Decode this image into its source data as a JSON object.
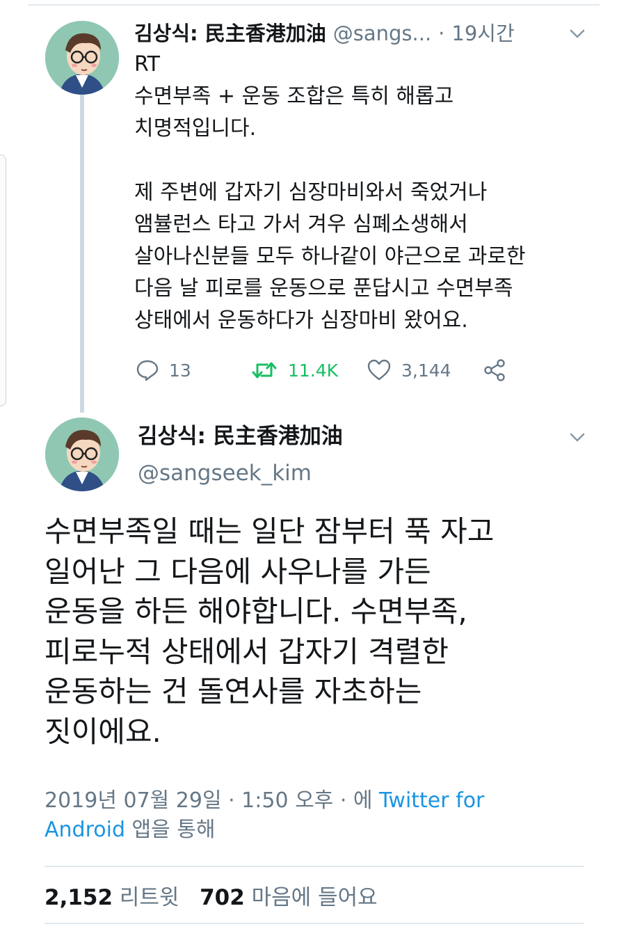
{
  "retweeted_tweet": {
    "display_name": "김상식: 民主香港加油",
    "handle_truncated": "@sangs...",
    "separator": "·",
    "time_ago": "19시간",
    "rt_label": "RT",
    "lines": [
      "수면부족 + 운동 조합은 특히 해롭고",
      "치명적입니다.",
      "",
      "제 주변에 갑자기 심장마비와서 죽었거나",
      "앰뷸런스 타고 가서 겨우 심폐소생해서",
      "살아나신분들 모두 하나같이 야근으로 과로한",
      "다음 날 피로를 운동으로 푼답시고 수면부족",
      "상태에서 운동하다가 심장마비 왔어요."
    ],
    "actions": {
      "replies": "13",
      "retweets": "11.4K",
      "likes": "3,144"
    },
    "icons": [
      "reply-icon",
      "retweet-icon",
      "like-icon",
      "share-icon",
      "chevron-down-icon"
    ],
    "colors": {
      "retweet_green": "#17bf63",
      "muted": "#657786"
    }
  },
  "main_tweet": {
    "display_name": "김상식: 民主香港加油",
    "handle": "@sangseek_kim",
    "lines": [
      "수면부족일 때는 일단 잠부터 푹 자고",
      "일어난 그 다음에 사우나를 가든",
      "운동을 하든 해야합니다. 수면부족,",
      "피로누적 상태에서 갑자기 격렬한",
      "운동하는 건 돌연사를 자초하는",
      "짓이에요."
    ],
    "timestamp": "2019년 07월 29일 · 1:50 오후 · 에",
    "source_link_1": "Twitter for",
    "source_link_2": "Android",
    "source_suffix": "앱을 통해",
    "retweet_count": "2,152",
    "retweet_label": "리트윗",
    "like_count": "702",
    "like_label": "마음에 들어요",
    "colors": {
      "link_blue": "#1b95e0"
    }
  }
}
